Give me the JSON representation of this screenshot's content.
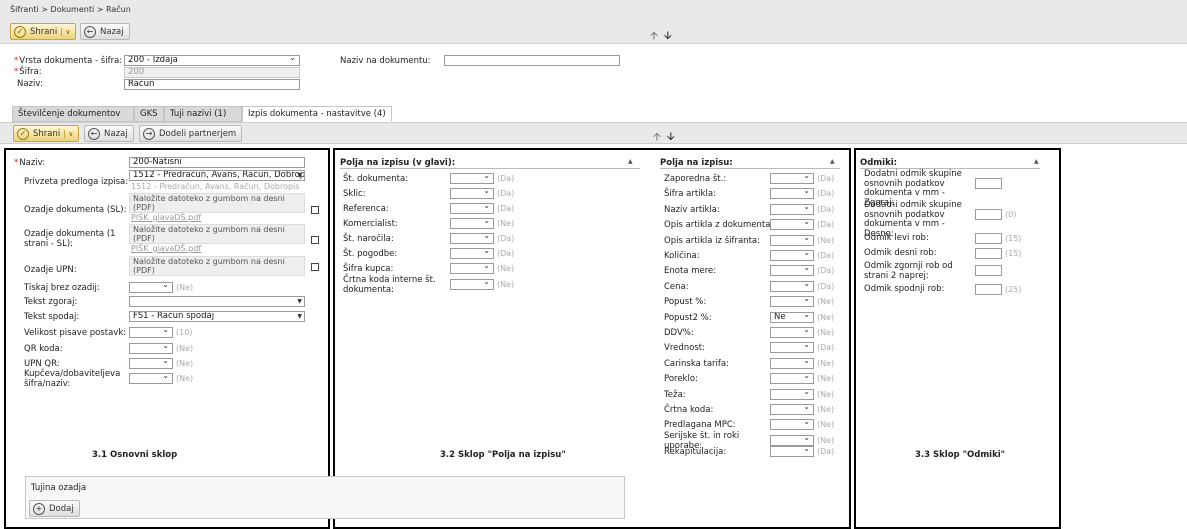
{
  "breadcrumb": "Šifranti > Dokumenti > Račun",
  "toolbar": {
    "save": "Shrani",
    "back": "Nazaj"
  },
  "header_form": {
    "vrsta_label": "Vrsta dokumenta - šifra:",
    "vrsta_value": "200 - Izdaja",
    "sifra_label": "Šifra:",
    "sifra_value": "200",
    "naziv_label": "Naziv:",
    "naziv_value": "Račun",
    "naziv_dok_label": "Naziv na dokumentu:",
    "naziv_dok_value": ""
  },
  "tabs": [
    "Številčenje dokumentov",
    "GKS",
    "Tuji nazivi (1)",
    "Izpis dokumenta - nastavitve (4)"
  ],
  "subtoolbar": {
    "save": "Shrani",
    "back": "Nazaj",
    "assign": "Dodeli partnerjem"
  },
  "section1": {
    "naziv_label": "Naziv:",
    "naziv_value": "200-Natisni",
    "predloga_label": "Privzeta predloga izpisa:",
    "predloga_value": "1512 - Predračun, Avans, Račun, Dobropis",
    "predloga_hint": "1512 - Predračun, Avans, Račun, Dobropis",
    "ozadje_sl_label": "Ozadje dokumenta (SL):",
    "upload_text": "Naložite datoteko z gumbom na desni (PDF)",
    "file_name": "PIŠK_glavaDŠ.pdf",
    "ozadje1_label": "Ozadje dokumenta (1 strani - SL):",
    "upn_label": "Ozadje UPN:",
    "tiskaj_label": "Tiskaj brez ozadij:",
    "tiskaj_hint": "(Ne)",
    "zgoraj_label": "Tekst zgoraj:",
    "spodaj_label": "Tekst spodaj:",
    "spodaj_value": "FS1 - Račun spodaj",
    "velikost_label": "Velikost pisave postavk:",
    "velikost_hint": "(10)",
    "qr_label": "QR koda:",
    "qr_hint": "(Ne)",
    "upnqr_label": "UPN QR:",
    "upnqr_hint": "(Ne)",
    "kupceva_label": "Kupčeva/dobaviteljeva šifra/naziv:",
    "kupceva_hint": "(Ne)",
    "caption": "3.1 Osnovni sklop",
    "tujina_title": "Tujina ozadja",
    "add": "Dodaj"
  },
  "section2a": {
    "title": "Polja na izpisu (v glavi):",
    "rows": [
      {
        "label": "Št. dokumenta:",
        "hint": "(Da)"
      },
      {
        "label": "Sklic:",
        "hint": "(Da)"
      },
      {
        "label": "Referenca:",
        "hint": "(Da)"
      },
      {
        "label": "Komercialist:",
        "hint": "(Ne)"
      },
      {
        "label": "Št. naročila:",
        "hint": "(Da)"
      },
      {
        "label": "Št. pogodbe:",
        "hint": "(Da)"
      },
      {
        "label": "Šifra kupca:",
        "hint": "(Ne)"
      },
      {
        "label": "Črtna koda interne št. dokumenta:",
        "hint": "(Ne)"
      }
    ],
    "caption": "3.2 Sklop \"Polja na izpisu\""
  },
  "section2b": {
    "title": "Polja na izpisu:",
    "rows": [
      {
        "label": "Zaporedna št.:",
        "value": "",
        "hint": "(Da)"
      },
      {
        "label": "Šifra artikla:",
        "value": "",
        "hint": "(Da)"
      },
      {
        "label": "Naziv artikla:",
        "value": "",
        "hint": "(Da)"
      },
      {
        "label": "Opis artikla z dokumenta:",
        "value": "",
        "hint": "(Da)"
      },
      {
        "label": "Opis artikla iz šifranta:",
        "value": "",
        "hint": "(Ne)"
      },
      {
        "label": "Količina:",
        "value": "",
        "hint": "(Da)"
      },
      {
        "label": "Enota mere:",
        "value": "",
        "hint": "(Da)"
      },
      {
        "label": "Cena:",
        "value": "",
        "hint": "(Da)"
      },
      {
        "label": "Popust %:",
        "value": "",
        "hint": "(Ne)"
      },
      {
        "label": "Popust2 %:",
        "value": "Ne",
        "hint": "(Ne)"
      },
      {
        "label": "DDV%:",
        "value": "",
        "hint": "(Ne)"
      },
      {
        "label": "Vrednost:",
        "value": "",
        "hint": "(Da)"
      },
      {
        "label": "Carinska tarifa:",
        "value": "",
        "hint": "(Ne)"
      },
      {
        "label": "Poreklo:",
        "value": "",
        "hint": "(Ne)"
      },
      {
        "label": "Teža:",
        "value": "",
        "hint": "(Ne)"
      },
      {
        "label": "Črtna koda:",
        "value": "",
        "hint": "(Ne)"
      },
      {
        "label": "Predlagana MPC:",
        "value": "",
        "hint": "(Ne)"
      },
      {
        "label": "Serijske št. in roki uporabe:",
        "value": "",
        "hint": "(Ne)"
      },
      {
        "label": "Rekapitulacija:",
        "value": "",
        "hint": "(Da)"
      }
    ]
  },
  "section3": {
    "title": "Odmiki:",
    "rows": [
      {
        "label": "Dodatni odmik skupine osnovnih podatkov dokumenta v mm - Zgoraj:",
        "hint": ""
      },
      {
        "label": "Dodatni odmik skupine osnovnih podatkov dokumenta v mm - Desno:",
        "hint": "(0)"
      },
      {
        "label": "Odmik levi rob:",
        "hint": "(15)"
      },
      {
        "label": "Odmik desni rob:",
        "hint": "(15)"
      },
      {
        "label": "Odmik zgornji rob od strani 2 naprej:",
        "hint": ""
      },
      {
        "label": "Odmik spodnji rob:",
        "hint": "(25)"
      }
    ],
    "caption": "3.3 Sklop \"Odmiki\""
  }
}
